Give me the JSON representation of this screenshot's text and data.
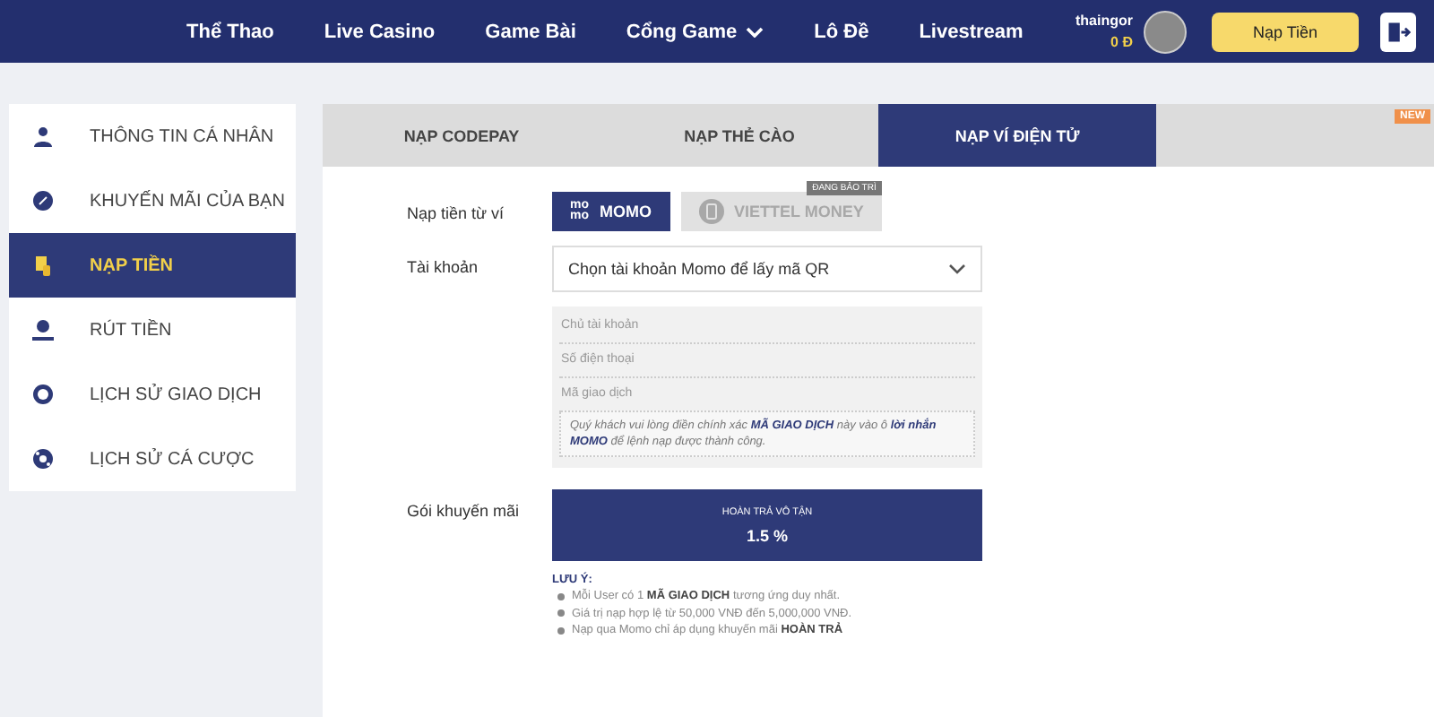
{
  "nav": {
    "items": [
      {
        "label": "Thể Thao",
        "dropdown": false
      },
      {
        "label": "Live Casino",
        "dropdown": false
      },
      {
        "label": "Game Bài",
        "dropdown": false
      },
      {
        "label": "Cổng Game",
        "dropdown": true
      },
      {
        "label": "Lô Đề",
        "dropdown": false
      },
      {
        "label": "Livestream",
        "dropdown": false
      }
    ],
    "user": {
      "name": "thaingor",
      "balance": "0 Đ"
    },
    "deposit_button": "Nạp Tiền"
  },
  "sidebar": {
    "items": [
      {
        "label": "THÔNG TIN CÁ NHÂN",
        "kind": "user",
        "selected": false
      },
      {
        "label": "KHUYẾN MÃI CỦA BẠN",
        "kind": "promo",
        "selected": false
      },
      {
        "label": "NẠP TIỀN",
        "kind": "deposit",
        "selected": true
      },
      {
        "label": "RÚT TIỀN",
        "kind": "withdraw",
        "selected": false
      },
      {
        "label": "LỊCH SỬ GIAO DỊCH",
        "kind": "history",
        "selected": false
      },
      {
        "label": "LỊCH SỬ CÁ CƯỢC",
        "kind": "ball",
        "selected": false
      }
    ]
  },
  "tabs": [
    {
      "label": "NẠP CODEPAY",
      "selected": false
    },
    {
      "label": "NẠP THẺ CÀO",
      "selected": false
    },
    {
      "label": "NẠP VÍ ĐIỆN TỬ",
      "selected": true
    },
    {
      "badge": "NEW",
      "selected": false
    }
  ],
  "form": {
    "wallet_label": "Nạp tiền từ ví",
    "wallets": [
      {
        "logo": "mo\nmo",
        "label": "MOMO",
        "selected": true,
        "disabled": false
      },
      {
        "label": "VIETTEL MONEY",
        "selected": false,
        "disabled": true,
        "badge": "ĐANG BẢO TRÌ"
      }
    ],
    "account_label": "Tài khoản",
    "account_select": "Chọn tài khoản Momo để lấy mã QR",
    "info_fields": [
      "Chủ tài khoản",
      "Số điện thoại",
      "Mã giao dịch"
    ],
    "info_note": "Quý khách vui lòng điền chính xác **MÃ GIAO DỊCH** này vào ô **lời nhắn MOMO** để lệnh nạp được thành công.",
    "promo_label": "Gói khuyến mãi",
    "promo": {
      "title": "HOÀN TRẢ VÔ TẬN",
      "value": "1.5 %",
      "selected": true
    },
    "notes_title": "LƯU Ý:",
    "notes": [
      "Mỗi User có 1 **MÃ GIAO DỊCH** tương ứng duy nhất.",
      "Giá trị nạp hợp lệ từ 50,000 VNĐ đến 5,000,000 VNĐ.",
      "Nạp qua Momo chỉ áp dụng khuyến mãi **HOÀN TRẢ**"
    ]
  }
}
